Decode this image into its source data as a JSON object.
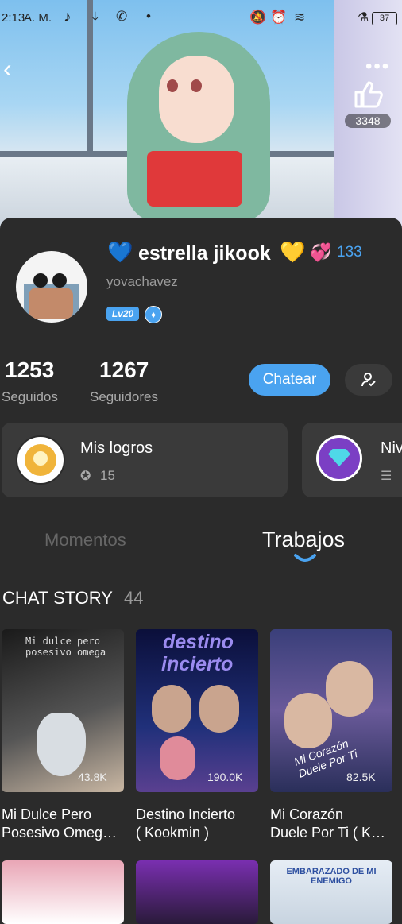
{
  "status_bar": {
    "time": "2:13",
    "ampm": "A. M.",
    "battery": "37"
  },
  "profile": {
    "name": "estrella jikook",
    "name_prefix_emoji": "💙",
    "name_suffix_emoji": "💛",
    "heart_emoji": "💞",
    "heart_count": "133",
    "username": "yovachavez",
    "level": "Lv20"
  },
  "likes": {
    "count": "3348"
  },
  "stats": {
    "following_count": "1253",
    "following_label": "Seguidos",
    "followers_count": "1267",
    "followers_label": "Seguidores"
  },
  "actions": {
    "chat_label": "Chatear"
  },
  "achievements": {
    "title": "Mis logros",
    "count": "15",
    "next_title": "Niv"
  },
  "tabs": [
    {
      "label": "Momentos",
      "active": false
    },
    {
      "label": "Trabajos",
      "active": true
    }
  ],
  "section": {
    "title": "CHAT STORY",
    "count": "44"
  },
  "stories": [
    {
      "title_l1": "Mi Dulce Pero",
      "title_l2": "Posesivo Omeg…",
      "views": "43.8K",
      "cover_text": "Mi dulce pero posesivo omega"
    },
    {
      "title_l1": "Destino Incierto",
      "title_l2": "( Kookmin )",
      "views": "190.0K",
      "cover_text_1": "destino",
      "cover_text_2": "incierto"
    },
    {
      "title_l1": "Mi Corazón",
      "title_l2": "Duele Por Ti ( K…",
      "views": "82.5K",
      "cover_text": "Mi Corazón Duele Por Ti"
    }
  ],
  "stories_row2": [
    {
      "cover_text": ""
    },
    {
      "cover_text": ""
    },
    {
      "cover_text": "EMBARAZADO DE MI ENEMIGO"
    }
  ],
  "colors": {
    "accent": "#4aa3f0",
    "panel": "#2b2b2b",
    "tile": "#3a3a3a"
  }
}
